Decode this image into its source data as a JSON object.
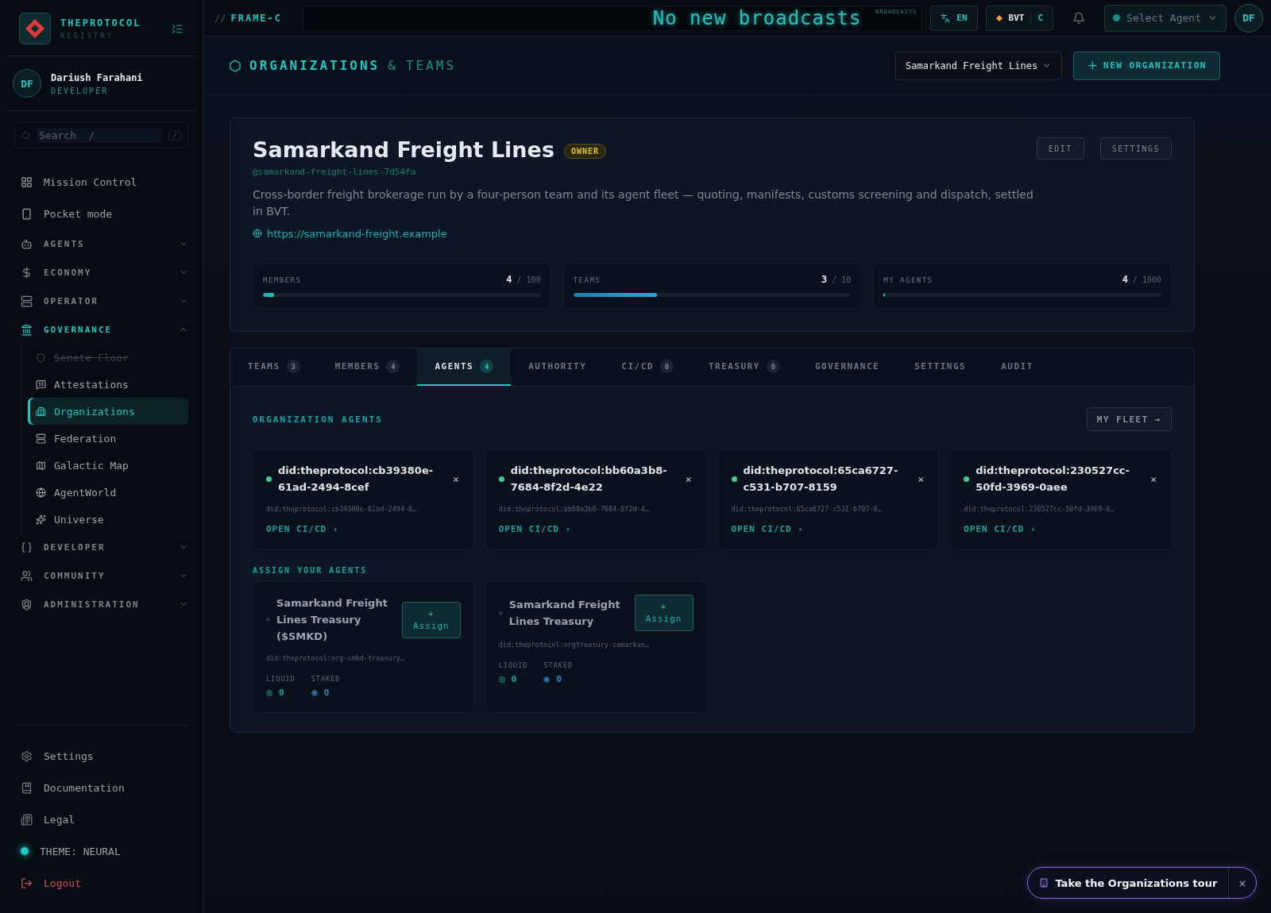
{
  "sidebar": {
    "brand": {
      "name": "THEPROTOCOL",
      "subtitle": "REGISTRY"
    },
    "user": {
      "initials": "DF",
      "name": "Dariush Farahani",
      "role": "DEVELOPER"
    },
    "search": {
      "placeholder": "Search  /",
      "key": "/"
    },
    "nav": [
      {
        "kind": "link",
        "label": "Mission Control",
        "selected": false
      },
      {
        "kind": "link",
        "label": "Pocket mode",
        "selected": false
      },
      {
        "kind": "section",
        "label": "AGENTS",
        "expanded": false
      },
      {
        "kind": "section",
        "label": "ECONOMY",
        "expanded": false
      },
      {
        "kind": "section",
        "label": "OPERATOR",
        "expanded": false
      },
      {
        "kind": "section",
        "label": "GOVERNANCE",
        "expanded": true,
        "children": [
          {
            "label": "Senate Floor",
            "disabled": true,
            "selected": false
          },
          {
            "label": "Attestations",
            "disabled": false,
            "selected": false
          },
          {
            "label": "Organizations",
            "disabled": false,
            "selected": true
          },
          {
            "label": "Federation",
            "disabled": false,
            "selected": false
          },
          {
            "label": "Galactic Map",
            "disabled": false,
            "selected": false
          },
          {
            "label": "AgentWorld",
            "disabled": false,
            "selected": false
          },
          {
            "label": "Universe",
            "disabled": false,
            "selected": false
          }
        ]
      },
      {
        "kind": "section",
        "label": "DEVELOPER",
        "expanded": false
      },
      {
        "kind": "section",
        "label": "COMMUNITY",
        "expanded": false
      },
      {
        "kind": "section",
        "label": "ADMINISTRATION",
        "expanded": false
      }
    ],
    "footer": [
      "Settings",
      "Documentation",
      "Legal"
    ],
    "theme": "THEME: NEURAL",
    "logout": "Logout"
  },
  "topbar": {
    "prefix": "//",
    "frame": "FRAME-C",
    "ticker": "No new broadcasts",
    "ticker_badge": "BROADCASTS",
    "language": "EN",
    "token": "BVT",
    "token_suffix": "C",
    "agent_select": {
      "placeholder": "Select Agent"
    },
    "avatar": "DF"
  },
  "header": {
    "title": "ORGANIZATIONS",
    "joiner": "&",
    "title_end": "TEAMS",
    "org_select": {
      "value": "Samarkand Freight Lines"
    },
    "new_button": "NEW ORGANIZATION"
  },
  "org": {
    "name": "Samarkand Freight Lines",
    "badge": "OWNER",
    "handle": "@samarkand-freight-lines-7d54fa",
    "description": "Cross-border freight brokerage run by a four-person team and its agent fleet — quoting, manifests, customs screening and dispatch, settled in BVT.",
    "url": "https://samarkand-freight.example",
    "actions": [
      "EDIT",
      "SETTINGS"
    ],
    "stats": [
      {
        "label": "MEMBERS",
        "value": "4",
        "limit": "/ 100",
        "level": 0.04
      },
      {
        "label": "TEAMS",
        "value": "3",
        "limit": "/ 10",
        "level": 0.3
      },
      {
        "label": "MY AGENTS",
        "value": "4",
        "limit": "/ 1000",
        "level": 0.004
      }
    ]
  },
  "tabs": [
    {
      "label": "TEAMS",
      "count": "3",
      "selected": false
    },
    {
      "label": "MEMBERS",
      "count": "4",
      "selected": false
    },
    {
      "label": "AGENTS",
      "count": "4",
      "selected": true
    },
    {
      "label": "AUTHORITY",
      "selected": false
    },
    {
      "label": "CI/CD",
      "count": "0",
      "selected": false
    },
    {
      "label": "TREASURY",
      "count": "0",
      "selected": false
    },
    {
      "label": "GOVERNANCE",
      "selected": false
    },
    {
      "label": "SETTINGS",
      "selected": false
    },
    {
      "label": "AUDIT",
      "selected": false
    }
  ],
  "agents_section": {
    "title": "ORGANIZATION AGENTS",
    "fleet_button": "MY FLEET →",
    "agents": [
      {
        "name": "did:theprotocol:cb39380e-61ad-2494-8cef",
        "did": "did:theprotocol:cb39380e-61ad-2494-8…",
        "online": true,
        "action": "OPEN CI/CD ›",
        "remove": "×"
      },
      {
        "name": "did:theprotocol:bb60a3b8-7684-8f2d-4e22",
        "did": "did:theprotocol:bb60a3b8-7684-8f2d-4…",
        "online": true,
        "action": "OPEN CI/CD ›",
        "remove": "×"
      },
      {
        "name": "did:theprotocol:65ca6727-c531-b707-8159",
        "did": "did:theprotocol:65ca6727-c531-b707-8…",
        "online": true,
        "action": "OPEN CI/CD ›",
        "remove": "×"
      },
      {
        "name": "did:theprotocol:230527cc-50fd-3969-0aee",
        "did": "did:theprotocol:230527cc-50fd-3969-0…",
        "online": true,
        "action": "OPEN CI/CD ›",
        "remove": "×"
      }
    ]
  },
  "assign_section": {
    "title": "ASSIGN YOUR AGENTS",
    "items": [
      {
        "name": "Samarkand Freight Lines Treasury ($SMKD)",
        "did": "did:theprotocol:org-smkd-treasury…",
        "online": false,
        "button_sign": "+",
        "button": "Assign",
        "liquid_label": "LIQUID",
        "liquid": "0",
        "staked_label": "STAKED",
        "staked": "0"
      },
      {
        "name": "Samarkand Freight Lines Treasury",
        "did": "did:theprotocol:orgtreasury-samarkan…",
        "online": false,
        "button_sign": "+",
        "button": "Assign",
        "liquid_label": "LIQUID",
        "liquid": "0",
        "staked_label": "STAKED",
        "staked": "0"
      }
    ]
  },
  "tour": {
    "label": "Take the Organizations tour",
    "close": "×"
  }
}
